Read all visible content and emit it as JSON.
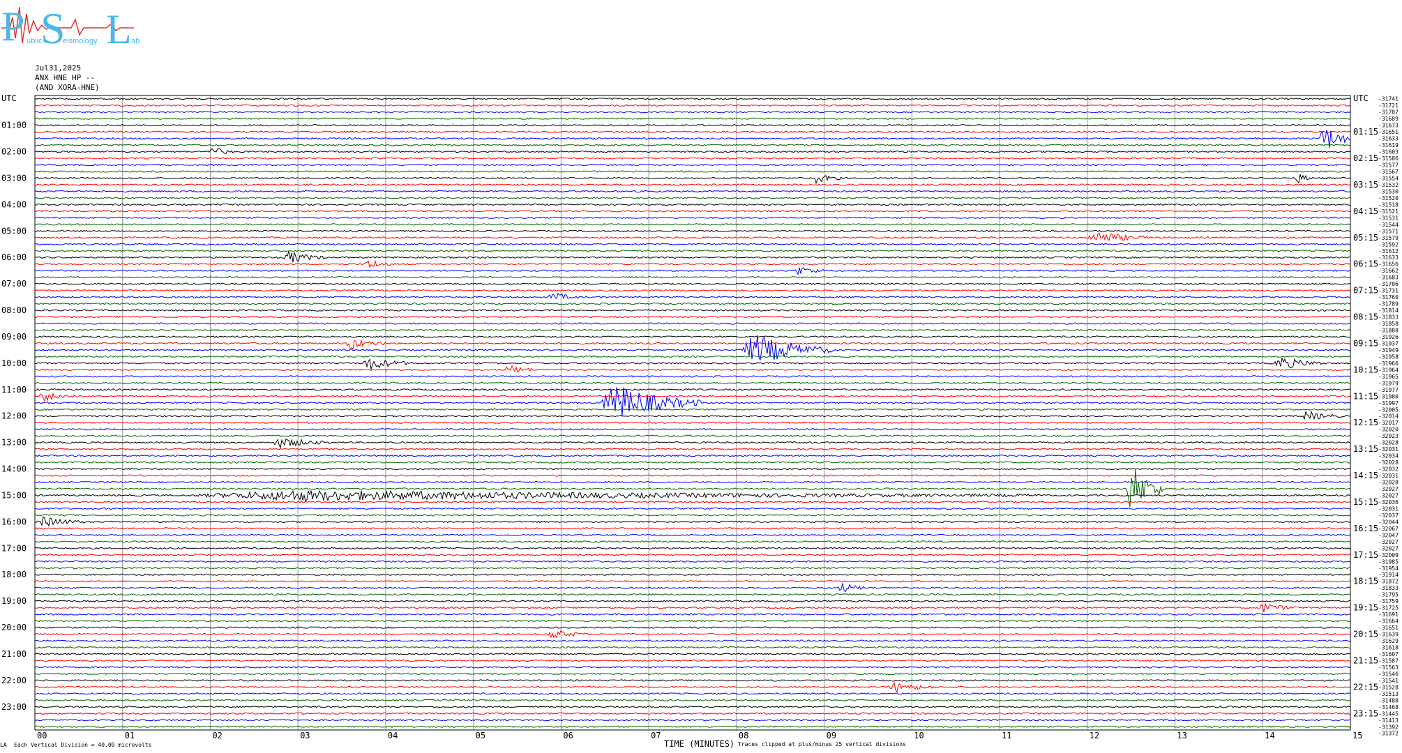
{
  "logo": {
    "big_letters": [
      "P",
      "S",
      "L"
    ],
    "small_text": [
      "ublic",
      "eismology",
      "ab"
    ],
    "color": "#4ab8e8",
    "trace_color": "#e83030"
  },
  "header": {
    "date": "Jul31,2025",
    "station": "ANX HNE HP --",
    "alt_station": "(AND XORA-HNE)"
  },
  "left_axis_title": "UTC",
  "right_axis_title": "UTC",
  "left_time_labels": [
    "01:00",
    "02:00",
    "03:00",
    "04:00",
    "05:00",
    "06:00",
    "07:00",
    "08:00",
    "09:00",
    "10:00",
    "11:00",
    "12:00",
    "13:00",
    "14:00",
    "15:00",
    "16:00",
    "17:00",
    "18:00",
    "19:00",
    "20:00",
    "21:00",
    "22:00",
    "23:00"
  ],
  "right_time_labels": [
    "01:15",
    "02:15",
    "03:15",
    "04:15",
    "05:15",
    "06:15",
    "07:15",
    "08:15",
    "09:15",
    "10:15",
    "11:15",
    "12:15",
    "13:15",
    "14:15",
    "15:15",
    "16:15",
    "17:15",
    "18:15",
    "19:15",
    "20:15",
    "21:15",
    "22:15",
    "23:15"
  ],
  "right_values": [
    "-31741",
    "-31721",
    "-31707",
    "-31689",
    "-31673",
    "-31651",
    "-31633",
    "-31619",
    "-31603",
    "-31586",
    "-31577",
    "-31567",
    "-31554",
    "-31532",
    "-31530",
    "-31520",
    "-31518",
    "-31521",
    "-31531",
    "-31544",
    "-31571",
    "-31579",
    "-31592",
    "-31612",
    "-31633",
    "-31656",
    "-31662",
    "-31683",
    "-31706",
    "-31731",
    "-31760",
    "-31789",
    "-31814",
    "-31833",
    "-31858",
    "-31888",
    "-31926",
    "-31937",
    "-31949",
    "-31958",
    "-31966",
    "-31964",
    "-31965",
    "-31979",
    "-31977",
    "-31980",
    "-31997",
    "-32005",
    "-32014",
    "-32017",
    "-32020",
    "-32023",
    "-32028",
    "-32031",
    "-32034",
    "-32028",
    "-32032",
    "-32031",
    "-32028",
    "-32027",
    "-32027",
    "-32036",
    "-32031",
    "-32037",
    "-32044",
    "-32067",
    "-32047",
    "-32027",
    "-32027",
    "-32009",
    "-31985",
    "-31954",
    "-31914",
    "-31872",
    "-31833",
    "-31795",
    "-31759",
    "-31725",
    "-31691",
    "-31664",
    "-31651",
    "-31639",
    "-31629",
    "-31618",
    "-31607",
    "-31587",
    "-31563",
    "-31546",
    "-31541",
    "-31528",
    "-31513",
    "-31488",
    "-31468",
    "-31445",
    "-31413",
    "-31392",
    "-31372"
  ],
  "x_ticks": [
    "00",
    "01",
    "02",
    "03",
    "04",
    "05",
    "06",
    "07",
    "08",
    "09",
    "10",
    "11",
    "12",
    "13",
    "14",
    "15"
  ],
  "x_axis_title": "TIME (MINUTES)",
  "clip_note": "Traces clipped at plus/minus 25 vertical divisions",
  "scale_note": "Each Vertical Division =   40.00 microvolts",
  "corner_mark": "LA",
  "chart_data": {
    "type": "line",
    "title": "",
    "xlabel": "TIME (MINUTES)",
    "ylabel": "UTC",
    "xlim": [
      0,
      15
    ],
    "rows": 96,
    "minutes_per_row": 15,
    "trace_colors": [
      "#000000",
      "#ff0000",
      "#0000ff",
      "#006400"
    ],
    "grid": "vertical lines every minute",
    "events": [
      {
        "row": 6,
        "minute": 14.7,
        "amplitude": 4,
        "duration": 0.4
      },
      {
        "row": 8,
        "minute": 2.0,
        "amplitude": 1.5,
        "duration": 0.3
      },
      {
        "row": 12,
        "minute": 8.9,
        "amplitude": 1.5,
        "duration": 0.3
      },
      {
        "row": 12,
        "minute": 14.4,
        "amplitude": 1.5,
        "duration": 0.2
      },
      {
        "row": 21,
        "minute": 12.1,
        "amplitude": 2,
        "duration": 0.6
      },
      {
        "row": 24,
        "minute": 2.9,
        "amplitude": 2,
        "duration": 0.4
      },
      {
        "row": 25,
        "minute": 3.8,
        "amplitude": 1.5,
        "duration": 0.3
      },
      {
        "row": 26,
        "minute": 8.7,
        "amplitude": 1.5,
        "duration": 0.3
      },
      {
        "row": 30,
        "minute": 5.9,
        "amplitude": 1.5,
        "duration": 0.3
      },
      {
        "row": 37,
        "minute": 3.6,
        "amplitude": 1.8,
        "duration": 0.4
      },
      {
        "row": 38,
        "minute": 8.2,
        "amplitude": 5,
        "duration": 0.9
      },
      {
        "row": 40,
        "minute": 3.8,
        "amplitude": 2,
        "duration": 0.5
      },
      {
        "row": 40,
        "minute": 14.2,
        "amplitude": 2,
        "duration": 0.5
      },
      {
        "row": 41,
        "minute": 5.4,
        "amplitude": 1.5,
        "duration": 0.3
      },
      {
        "row": 45,
        "minute": 0.1,
        "amplitude": 1.5,
        "duration": 0.4
      },
      {
        "row": 46,
        "minute": 6.6,
        "amplitude": 6,
        "duration": 1.0
      },
      {
        "row": 48,
        "minute": 14.5,
        "amplitude": 1.5,
        "duration": 0.4
      },
      {
        "row": 52,
        "minute": 2.8,
        "amplitude": 1.5,
        "duration": 0.6
      },
      {
        "row": 59,
        "minute": 12.5,
        "amplitude": 8,
        "duration": 0.4
      },
      {
        "row": 60,
        "minute": 3.0,
        "amplitude": 1.5,
        "duration": 8.5
      },
      {
        "row": 64,
        "minute": 0.1,
        "amplitude": 1.5,
        "duration": 0.5
      },
      {
        "row": 74,
        "minute": 9.2,
        "amplitude": 1.5,
        "duration": 0.3
      },
      {
        "row": 77,
        "minute": 14.0,
        "amplitude": 1.5,
        "duration": 0.4
      },
      {
        "row": 81,
        "minute": 5.9,
        "amplitude": 1.5,
        "duration": 0.4
      },
      {
        "row": 89,
        "minute": 9.8,
        "amplitude": 1.5,
        "duration": 0.5
      }
    ]
  }
}
